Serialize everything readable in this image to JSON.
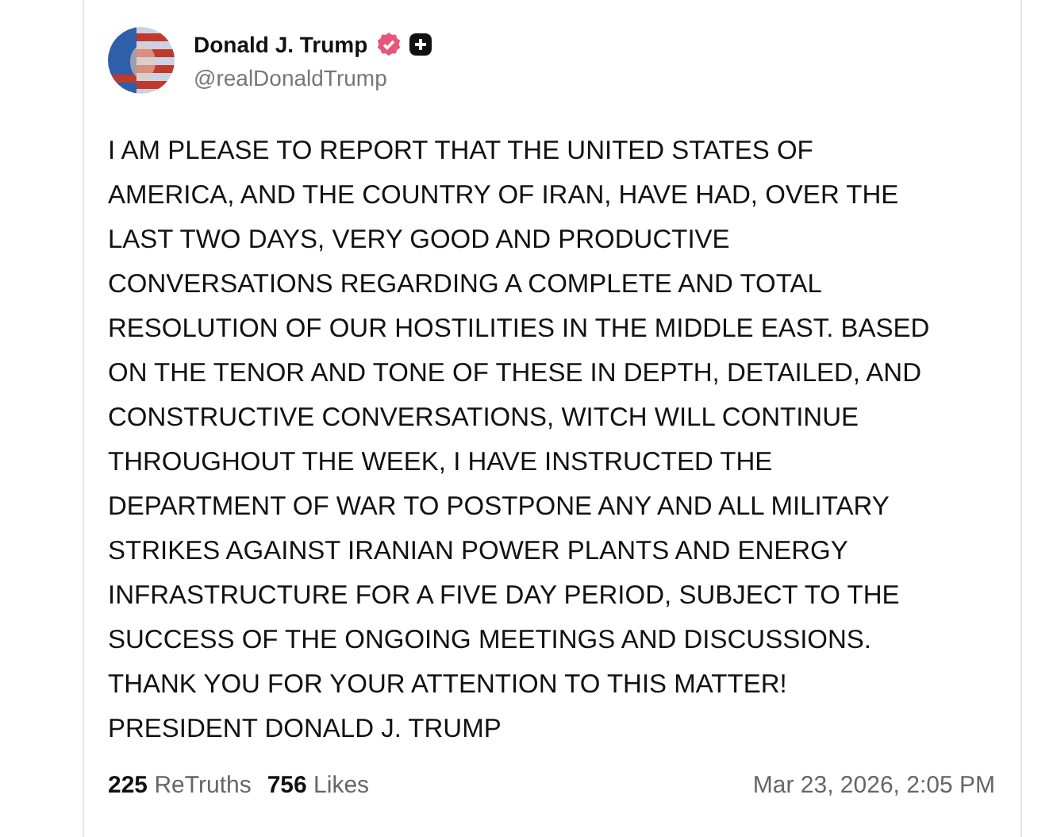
{
  "post": {
    "author": {
      "name": "Donald J. Trump",
      "verified": true,
      "handle": "@realDonaldTrump"
    },
    "body_lines": [
      "I AM PLEASE TO REPORT THAT THE UNITED STATES OF",
      "AMERICA, AND THE COUNTRY OF IRAN, HAVE HAD, OVER THE",
      "LAST TWO DAYS, VERY GOOD AND PRODUCTIVE",
      "CONVERSATIONS REGARDING A COMPLETE AND TOTAL",
      "RESOLUTION OF OUR HOSTILITIES IN THE MIDDLE EAST. BASED",
      "ON THE TENOR AND TONE OF THESE IN DEPTH, DETAILED, AND",
      "CONSTRUCTIVE CONVERSATIONS, WITCH WILL CONTINUE",
      "THROUGHOUT THE WEEK, I HAVE INSTRUCTED THE",
      "DEPARTMENT OF WAR TO POSTPONE ANY AND ALL MILITARY",
      "STRIKES AGAINST IRANIAN POWER PLANTS AND ENERGY",
      "INFRASTRUCTURE FOR A FIVE DAY PERIOD, SUBJECT TO THE",
      "SUCCESS OF THE ONGOING MEETINGS AND DISCUSSIONS.",
      "THANK YOU FOR YOUR ATTENTION TO THIS MATTER!",
      "PRESIDENT DONALD J. TRUMP"
    ],
    "stats": [
      {
        "count": "225",
        "label": "ReTruths"
      },
      {
        "count": "756",
        "label": "Likes"
      }
    ],
    "timestamp": "Mar 23, 2026, 2:05 PM"
  }
}
